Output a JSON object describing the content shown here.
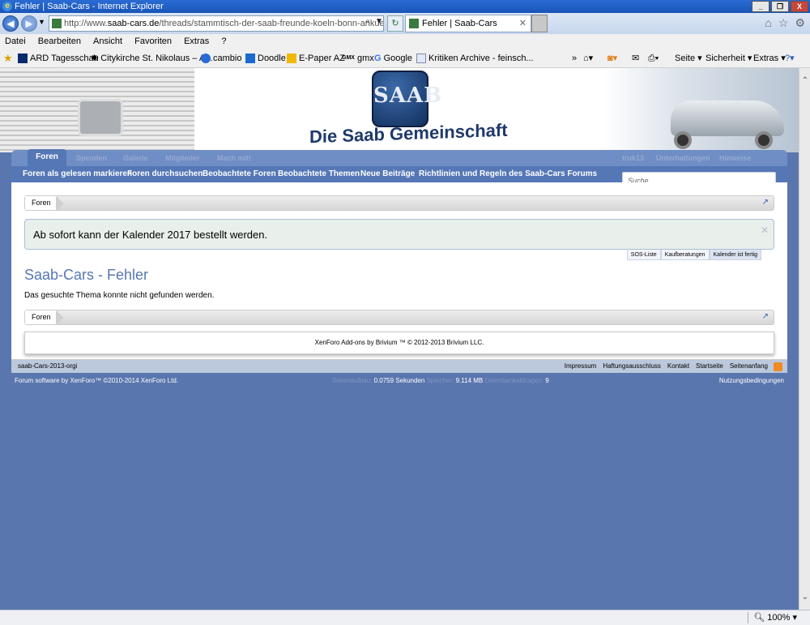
{
  "window": {
    "title": "Fehler | Saab-Cars - Internet Explorer"
  },
  "browser": {
    "url_prefix": "http://www.",
    "url_domain": "saab-cars.de",
    "url_path": "/threads/stammtisch-der-saab-freunde-koeln-bonn-ankuendig",
    "tab_title": "Fehler | Saab-Cars",
    "zoom": "100%"
  },
  "menu": [
    "Datei",
    "Bearbeiten",
    "Ansicht",
    "Favoriten",
    "Extras",
    "?"
  ],
  "favorites": [
    "ARD Tagesschau",
    "Citykirche St. Nikolaus – A...",
    "cambio",
    "Doodle",
    "E-Paper AZ",
    "gmx",
    "Google",
    "Kritiken Archive - feinsch..."
  ],
  "commands": {
    "page": "Seite",
    "security": "Sicherheit",
    "tools": "Extras"
  },
  "site": {
    "logo_text": "SAAB",
    "tagline": "Die Saab Gemeinschaft",
    "tabs": [
      "Foren",
      "Spenden",
      "Galerie",
      "Mitglieder",
      "Mach mit!"
    ],
    "user_tabs": [
      "truk13",
      "Unterhaltungen",
      "Hinweise"
    ],
    "subnav": [
      "Foren als gelesen markieren",
      "Foren durchsuchen",
      "Beobachtete Foren",
      "Beobachtete Themen",
      "Neue Beiträge",
      "Richtlinien und Regeln des Saab-Cars Forums"
    ],
    "search_placeholder": "Suche...",
    "breadcrumb": "Foren",
    "notice": "Ab sofort kann der Kalender 2017 bestellt werden.",
    "notice_tabs": [
      "SOS-Liste",
      "Kaufberatungen",
      "Kalender ist fertig"
    ],
    "error_title": "Saab-Cars - Fehler",
    "error_text": "Das gesuchte Thema konnte nicht gefunden werden.",
    "brivium": "XenForo Add-ons by Brivium ™ © 2012-2013 Brivium LLC.",
    "style_name": "saab-Cars-2013-orgi",
    "footer_links": [
      "Impressum",
      "Haftungsausschluss",
      "Kontakt",
      "Startseite",
      "Seitenanfang"
    ],
    "copyright": "Forum software by XenForo™ ©2010-2014 XenForo Ltd.",
    "debug": {
      "time_label": "Seitenaufbau:",
      "time": "0.0759 Sekunden",
      "mem_label": "Speicher:",
      "mem": "9.114 MB",
      "queries_label": "Datenbankabfragen:",
      "queries": "9"
    },
    "terms": "Nutzungsbedingungen"
  }
}
